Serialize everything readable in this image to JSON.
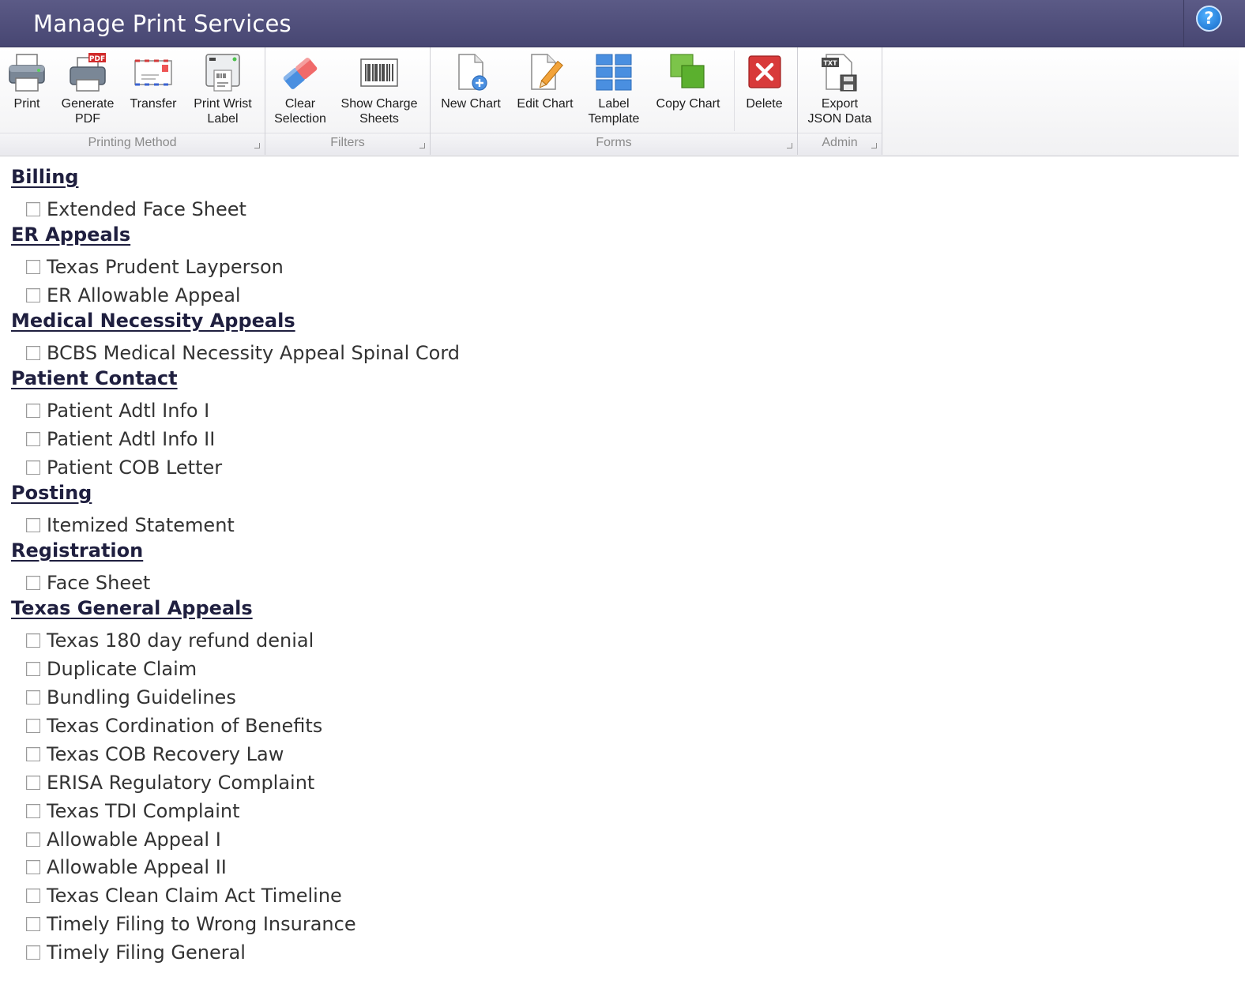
{
  "window": {
    "title": "Manage Print Services",
    "help_label": "?"
  },
  "ribbon": {
    "groups": [
      {
        "label": "Printing Method",
        "buttons": [
          {
            "label": "Print",
            "icon": "printer-icon"
          },
          {
            "label": "Generate\nPDF",
            "icon": "pdf-printer-icon"
          },
          {
            "label": "Transfer",
            "icon": "envelope-icon"
          },
          {
            "label": "Print Wrist\nLabel",
            "icon": "wristband-printer-icon"
          }
        ]
      },
      {
        "label": "Filters",
        "buttons": [
          {
            "label": "Clear\nSelection",
            "icon": "eraser-icon"
          },
          {
            "label": "Show Charge\nSheets",
            "icon": "barcode-icon"
          }
        ]
      },
      {
        "label": "Forms",
        "buttons": [
          {
            "label": "New Chart",
            "icon": "new-document-icon"
          },
          {
            "label": "Edit Chart",
            "icon": "edit-document-icon"
          },
          {
            "label": "Label\nTemplate",
            "icon": "grid-template-icon"
          },
          {
            "label": "Copy Chart",
            "icon": "copy-icon"
          },
          {
            "label": "Delete",
            "icon": "delete-icon"
          }
        ]
      },
      {
        "label": "Admin",
        "buttons": [
          {
            "label": "Export\nJSON Data",
            "icon": "export-file-icon"
          }
        ]
      }
    ]
  },
  "categories": [
    {
      "name": "Billing",
      "items": [
        "Extended Face Sheet"
      ]
    },
    {
      "name": "ER Appeals",
      "items": [
        "Texas Prudent Layperson",
        "ER Allowable Appeal"
      ]
    },
    {
      "name": "Medical Necessity Appeals",
      "items": [
        "BCBS Medical Necessity Appeal Spinal Cord"
      ]
    },
    {
      "name": "Patient Contact",
      "items": [
        "Patient Adtl Info I",
        "Patient Adtl Info II",
        "Patient COB Letter"
      ]
    },
    {
      "name": "Posting",
      "items": [
        "Itemized Statement"
      ]
    },
    {
      "name": "Registration",
      "items": [
        "Face Sheet"
      ]
    },
    {
      "name": "Texas General Appeals",
      "items": [
        "Texas 180 day refund denial",
        "Duplicate Claim",
        "Bundling Guidelines",
        "Texas Cordination of Benefits",
        "Texas COB Recovery Law",
        "ERISA Regulatory Complaint",
        "Texas TDI Complaint",
        "Allowable Appeal I",
        "Allowable Appeal II",
        "Texas Clean Claim Act Timeline",
        "Timely Filing to Wrong Insurance",
        "Timely Filing General"
      ]
    }
  ]
}
